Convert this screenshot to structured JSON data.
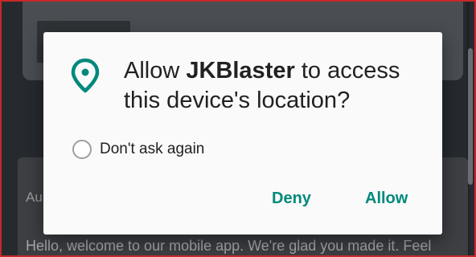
{
  "background": {
    "partial_text": "Au",
    "welcome_text": "Hello, welcome to our mobile app. We're glad you made it. Feel"
  },
  "dialog": {
    "title_prefix": "Allow ",
    "app_name": "JKBlaster",
    "title_suffix": " to access this device's location?",
    "icon": "location-pin-icon",
    "checkbox_label": "Don't ask again",
    "checkbox_checked": false,
    "deny_label": "Deny",
    "allow_label": "Allow",
    "accent_color": "#00897b"
  }
}
